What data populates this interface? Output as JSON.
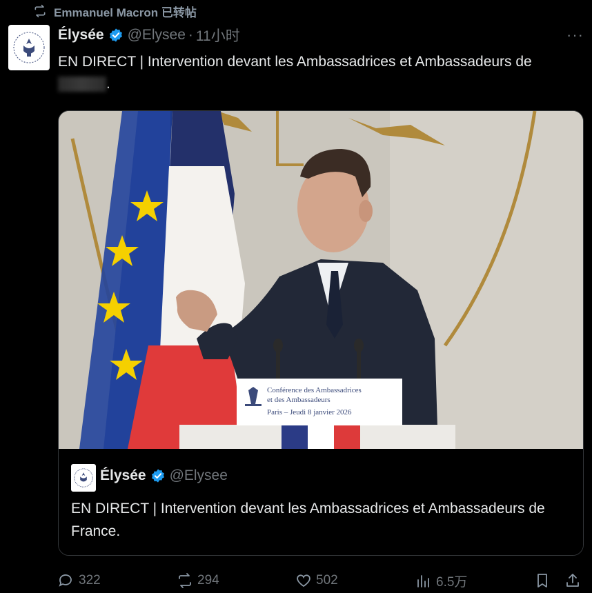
{
  "retweet": {
    "text": "Emmanuel Macron 已转帖"
  },
  "tweet": {
    "author": "Élysée",
    "handle": "@Elysee",
    "separator": "·",
    "time": "11小时",
    "more": "···",
    "text": "EN DIRECT | Intervention devant les Ambassadrices et Ambassadeurs de",
    "text_tail": "."
  },
  "media": {
    "podium_line1": "Conférence des Ambassadrices",
    "podium_line2": "et des Ambassadeurs",
    "podium_line3": "Paris – Jeudi 8 janvier 2026"
  },
  "quote": {
    "author": "Élysée",
    "handle": "@Elysee",
    "text": "EN DIRECT | Intervention devant les Ambassadrices et Ambassadeurs de France."
  },
  "actions": {
    "replies": "322",
    "reposts": "294",
    "likes": "502",
    "views": "6.5万"
  },
  "colors": {
    "background": "#000000",
    "muted": "#71767b",
    "verified": "#1d9bf0",
    "text": "#e7e9ea"
  }
}
